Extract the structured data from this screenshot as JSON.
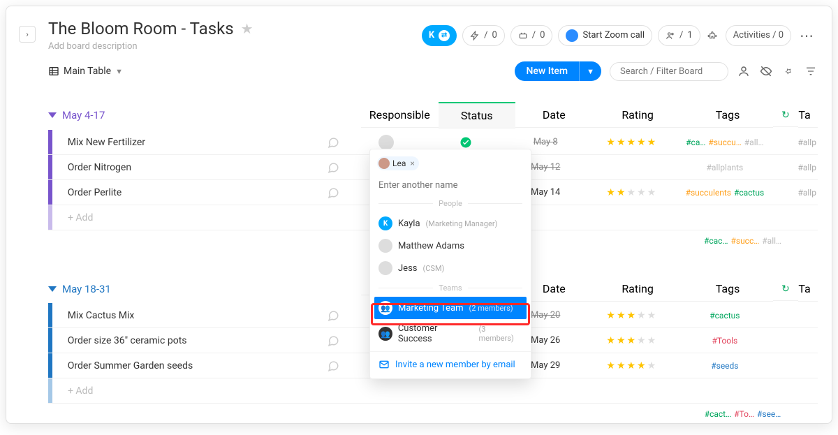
{
  "header": {
    "title": "The Bloom Room - Tasks",
    "description_placeholder": "Add board description",
    "badge_letter": "K",
    "counter1": "0",
    "counter2": "0",
    "zoom_label": "Start Zoom call",
    "members_count": "1",
    "activities_label": "Activities / 0"
  },
  "toolbar": {
    "view": "Main Table",
    "new_item": "New Item",
    "search_placeholder": "Search / Filter Board"
  },
  "columns": {
    "responsible": "Responsible",
    "status": "Status",
    "date": "Date",
    "rating": "Rating",
    "tags": "Tags",
    "extra": "Ta"
  },
  "add_label": "+ Add",
  "colors": {
    "group1": "#7854cc",
    "group2": "#1f76c2",
    "done": "#00c875",
    "alert": "#e2445c",
    "tag_green": "#00a65d",
    "tag_orange": "#ff9f1a",
    "tag_red": "#e2445c",
    "tag_blue": "#1f76c2",
    "tag_gray": "#bbb"
  },
  "group1": {
    "title": "May 4-17",
    "tasks": [
      {
        "name": "Mix New Fertilizer",
        "date": "May 8",
        "date_strike": true,
        "status": "done",
        "stars": 5,
        "tags": [
          {
            "t": "#ca…",
            "c": "green"
          },
          {
            "t": "#succu…",
            "c": "orange"
          },
          {
            "t": "#all…",
            "c": "gray"
          }
        ],
        "extra": "#allp"
      },
      {
        "name": "Order Nitrogen",
        "date": "May 12",
        "date_strike": true,
        "status": "done",
        "stars": 0,
        "tags": [
          {
            "t": "#allplants",
            "c": "gray"
          }
        ],
        "extra": "#allp"
      },
      {
        "name": "Order Perlite",
        "date": "May 14",
        "date_strike": false,
        "status": "alert",
        "stars": 2,
        "tags": [
          {
            "t": "#succulents",
            "c": "orange"
          },
          {
            "t": "#cactus",
            "c": "green"
          }
        ],
        "extra": "#allp"
      }
    ],
    "summary_tags": [
      {
        "t": "#cac…",
        "c": "green"
      },
      {
        "t": "#succ…",
        "c": "orange"
      },
      {
        "t": "#all…",
        "c": "gray"
      }
    ]
  },
  "group2": {
    "title": "May 18-31",
    "tasks": [
      {
        "name": "Mix Cactus Mix",
        "date": "May 20",
        "date_strike": true,
        "status": "done",
        "stars": 3,
        "tags": [
          {
            "t": "#cactus",
            "c": "green"
          }
        ],
        "extra": ""
      },
      {
        "name": "Order size 36\" ceramic pots",
        "date": "May 26",
        "date_strike": false,
        "status": "alert",
        "stars": 3,
        "tags": [
          {
            "t": "#Tools",
            "c": "red"
          }
        ],
        "extra": ""
      },
      {
        "name": "Order Summer Garden seeds",
        "date": "May 29",
        "date_strike": false,
        "status": "alert",
        "stars": 4,
        "tags": [
          {
            "t": "#seeds",
            "c": "blue"
          }
        ],
        "extra": ""
      }
    ],
    "summary_tags": [
      {
        "t": "#cact…",
        "c": "green"
      },
      {
        "t": "#To…",
        "c": "red"
      },
      {
        "t": "#see…",
        "c": "blue"
      }
    ]
  },
  "dropdown": {
    "chip_name": "Lea",
    "input_placeholder": "Enter another name",
    "people_label": "People",
    "teams_label": "Teams",
    "people": [
      {
        "name": "Kayla",
        "sub": "(Marketing Manager)",
        "avatar": "k"
      },
      {
        "name": "Matthew Adams",
        "sub": "",
        "avatar": "m"
      },
      {
        "name": "Jess",
        "sub": "(CSM)",
        "avatar": "j"
      }
    ],
    "teams": [
      {
        "name": "Marketing Team",
        "sub": "(2 members)",
        "highlight": true
      },
      {
        "name": "Customer Success",
        "sub": "(3 members)",
        "highlight": false
      }
    ],
    "invite": "Invite a new member by email"
  }
}
